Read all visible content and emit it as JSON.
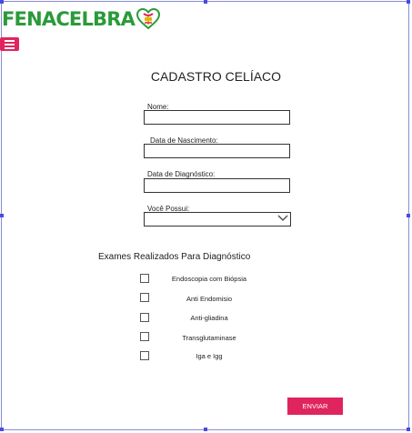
{
  "header": {
    "logo_text": "FENACELBRA"
  },
  "form": {
    "title": "CADASTRO CELÍACO",
    "name_label": "Nome:",
    "name_value": "",
    "birth_label": "Data de Nascimento:",
    "birth_value": "",
    "diagnosis_date_label": "Data de Diagnóstico:",
    "diagnosis_date_value": "",
    "possess_label": "Você Possui:",
    "possess_selected": ""
  },
  "exams": {
    "title": "Exames Realizados Para Diagnóstico",
    "items": [
      {
        "label": "Endoscopia com Biópsia",
        "checked": false
      },
      {
        "label": "Anti Endomisio",
        "checked": false
      },
      {
        "label": "Anti-gliadina",
        "checked": false
      },
      {
        "label": "Transglutaminase",
        "checked": false
      },
      {
        "label": "Iga e Igg",
        "checked": false
      }
    ]
  },
  "submit": {
    "label": "ENVIAR"
  },
  "colors": {
    "brand_green": "#2a9a3a",
    "accent_pink": "#e0245e",
    "frame_blue": "#4a4ae0"
  }
}
